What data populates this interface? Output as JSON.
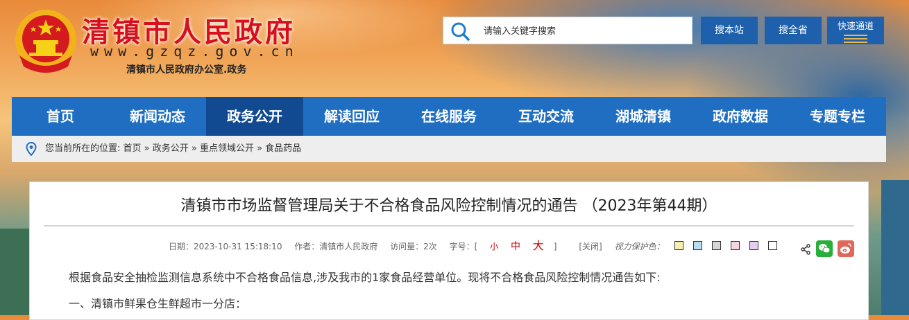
{
  "site": {
    "name": "清镇市人民政府",
    "domain": "www.gzqz.gov.cn",
    "subtitle": "清镇市人民政府办公室.政务"
  },
  "search": {
    "placeholder": "请输入关键字搜索",
    "buttons": {
      "local": "搜本站",
      "province": "搜全省",
      "quick": "快速通道"
    }
  },
  "nav": {
    "items": [
      "首页",
      "新闻动态",
      "政务公开",
      "解读回应",
      "在线服务",
      "互动交流",
      "湖城清镇",
      "政府数据",
      "专题专栏"
    ],
    "active_index": 2
  },
  "breadcrumb": {
    "text": "您当前所在的位置: 首页 » 政务公开 » 重点领域公开 » 食品药品"
  },
  "article": {
    "title": "清镇市市场监督管理局关于不合格食品风险控制情况的通告 （2023年第44期）",
    "meta": {
      "date": "日期：2023-10-31 15:18:10",
      "author": "作者：清镇市人民政府",
      "views": "访问量：2次",
      "font_label": "字号：[",
      "font_small": "小",
      "font_mid": "中",
      "font_big": "大",
      "font_end": "]",
      "close": "[关闭]",
      "care": "视力保护色："
    },
    "care_colors": [
      "#f5efb0",
      "#b8dcf1",
      "#d7d7d7",
      "#f4d6e2",
      "#e3cff0",
      "#ffffff"
    ],
    "paragraphs": [
      "根据食品安全抽检监测信息系统中不合格食品信息,涉及我市的1家食品经营单位。现将不合格食品风险控制情况通告如下:",
      "一、清镇市鲜果仓生鲜超市一分店："
    ]
  },
  "colors": {
    "brand_red": "#d7101b",
    "nav_blue": "#1f6ec2",
    "nav_active": "#114a91",
    "button_blue": "#1f60ac"
  }
}
